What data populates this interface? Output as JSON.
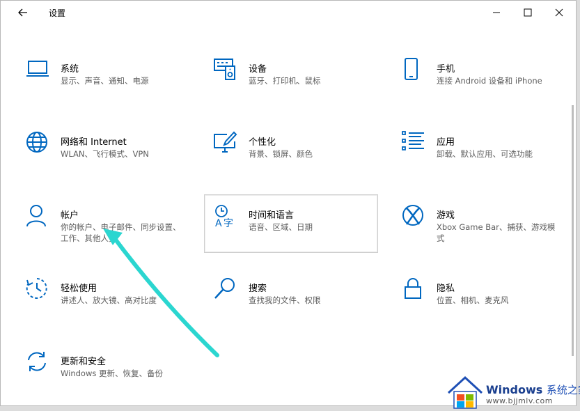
{
  "window": {
    "title": "设置"
  },
  "tiles": [
    {
      "name": "系统",
      "desc": "显示、声音、通知、电源",
      "icon": "laptop-icon"
    },
    {
      "name": "设备",
      "desc": "蓝牙、打印机、鼠标",
      "icon": "keyboard-speaker-icon"
    },
    {
      "name": "手机",
      "desc": "连接 Android 设备和 iPhone",
      "icon": "phone-icon"
    },
    {
      "name": "网络和 Internet",
      "desc": "WLAN、飞行模式、VPN",
      "icon": "globe-icon"
    },
    {
      "name": "个性化",
      "desc": "背景、锁屏、颜色",
      "icon": "paint-monitor-icon"
    },
    {
      "name": "应用",
      "desc": "卸载、默认应用、可选功能",
      "icon": "apps-list-icon"
    },
    {
      "name": "帐户",
      "desc": "你的帐户、电子邮件、同步设置、工作、其他人员",
      "icon": "person-icon"
    },
    {
      "name": "时间和语言",
      "desc": "语音、区域、日期",
      "icon": "time-language-icon"
    },
    {
      "name": "游戏",
      "desc": "Xbox Game Bar、捕获、游戏模式",
      "icon": "xbox-icon"
    },
    {
      "name": "轻松使用",
      "desc": "讲述人、放大镜、高对比度",
      "icon": "ease-of-access-icon"
    },
    {
      "name": "搜索",
      "desc": "查找我的文件、权限",
      "icon": "search-icon"
    },
    {
      "name": "隐私",
      "desc": "位置、相机、麦克风",
      "icon": "lock-icon"
    },
    {
      "name": "更新和安全",
      "desc": "Windows 更新、恢复、备份",
      "icon": "sync-arrows-icon"
    }
  ],
  "watermark": {
    "brand": "Windows",
    "brand_cn": "系统之家",
    "url": "www.bjjmlv.com"
  },
  "colors": {
    "accent": "#0067c0",
    "annotation_arrow": "#2bd6d0"
  }
}
